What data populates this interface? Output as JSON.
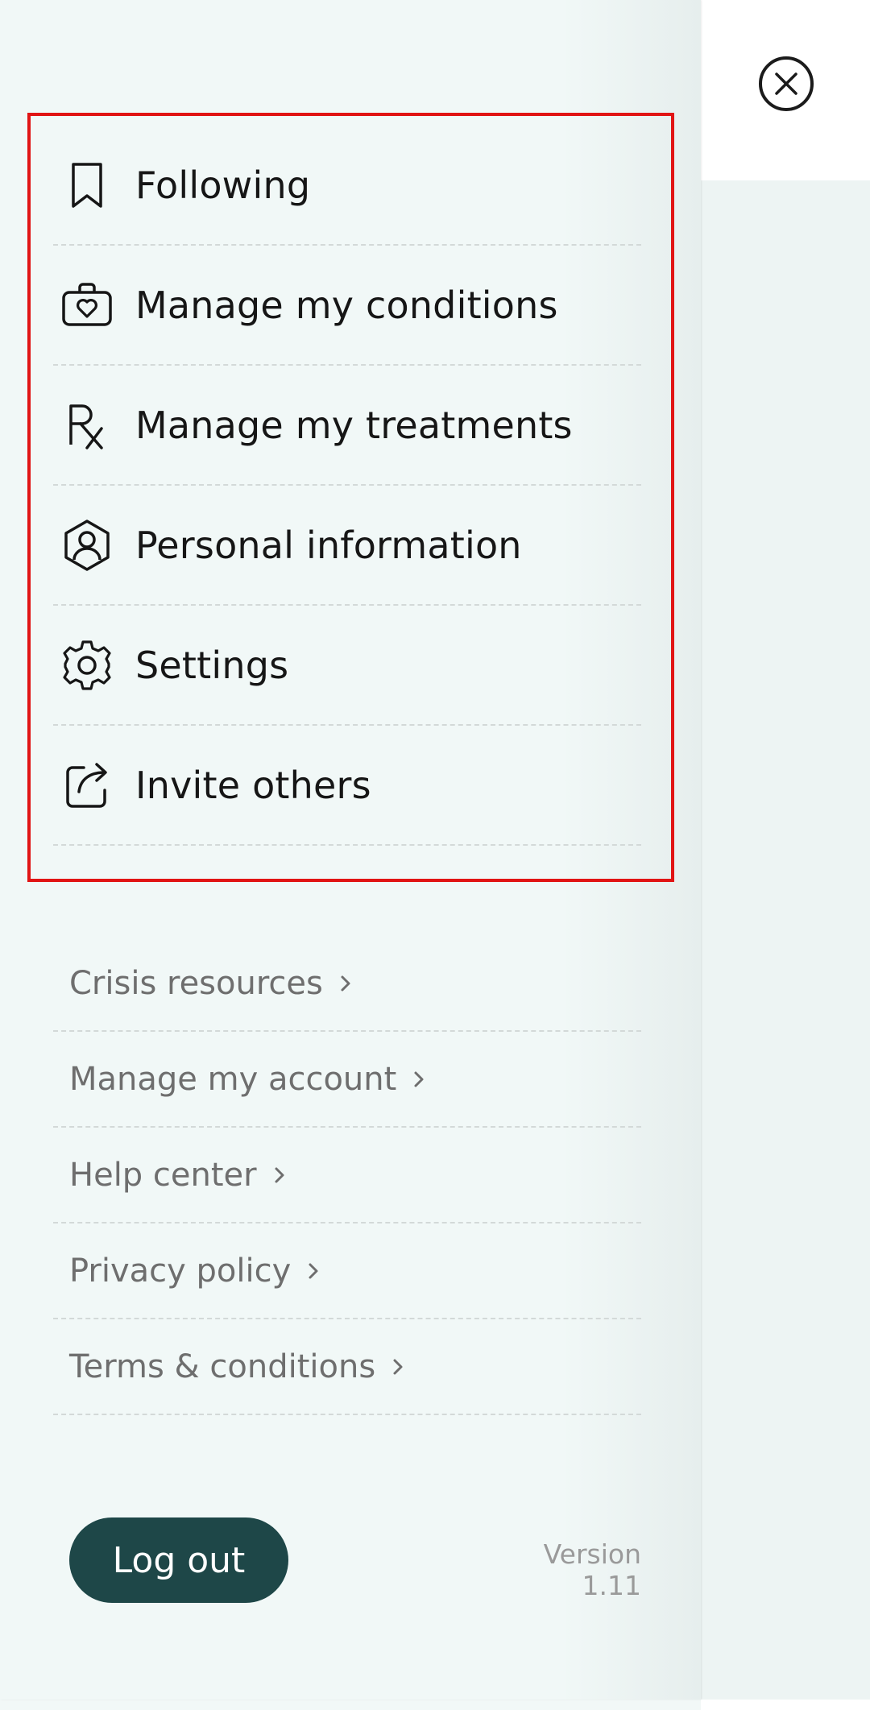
{
  "menu": {
    "items": [
      {
        "label": "Following",
        "icon": "bookmark-icon"
      },
      {
        "label": "Manage my conditions",
        "icon": "medical-bag-heart-icon"
      },
      {
        "label": "Manage my treatments",
        "icon": "rx-icon"
      },
      {
        "label": "Personal information",
        "icon": "user-hexagon-icon"
      },
      {
        "label": "Settings",
        "icon": "gear-icon"
      },
      {
        "label": "Invite others",
        "icon": "share-out-icon"
      }
    ]
  },
  "links": {
    "items": [
      {
        "label": "Crisis resources"
      },
      {
        "label": "Manage my account"
      },
      {
        "label": "Help center"
      },
      {
        "label": "Privacy policy"
      },
      {
        "label": "Terms & conditions"
      }
    ]
  },
  "footer": {
    "logout_label": "Log out",
    "version": "Version 1.11"
  },
  "colors": {
    "drawer_bg": "#f1f8f7",
    "primary_button": "#1e4748",
    "highlight": "#e11414"
  }
}
